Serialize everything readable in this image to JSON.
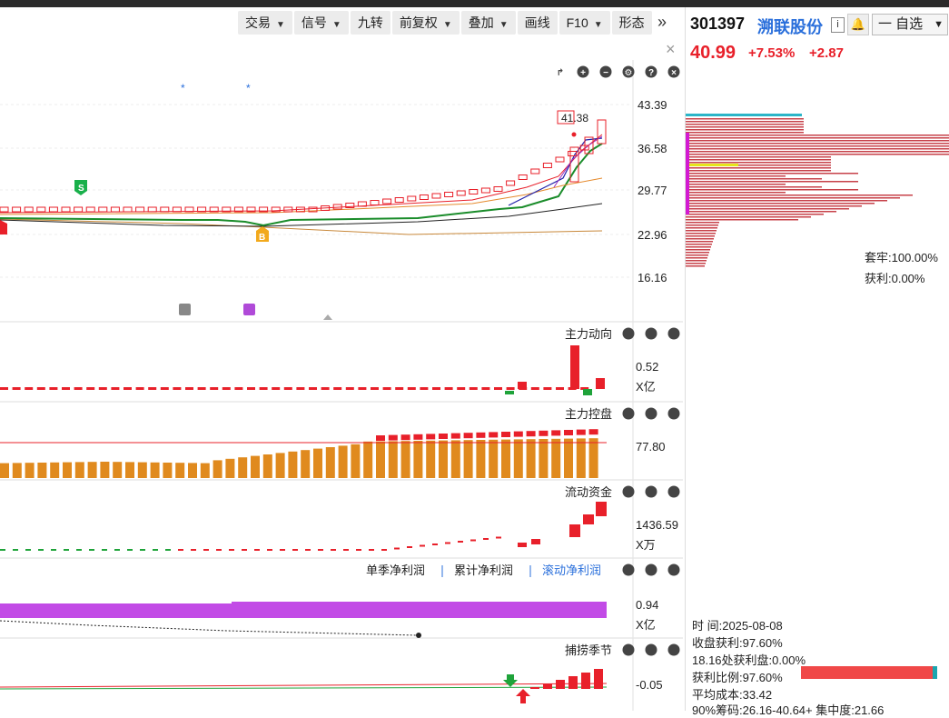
{
  "toolbar": {
    "items": [
      {
        "label": "交易",
        "dropdown": true
      },
      {
        "label": "信号",
        "dropdown": true
      },
      {
        "label": "九转",
        "dropdown": false
      },
      {
        "label": "前复权",
        "dropdown": true
      },
      {
        "label": "叠加",
        "dropdown": true
      },
      {
        "label": "画线",
        "dropdown": false
      },
      {
        "label": "F10",
        "dropdown": true
      },
      {
        "label": "形态",
        "dropdown": false
      }
    ],
    "more_icon": "double-chevron-right-icon",
    "close_icon": "close-icon"
  },
  "chart_controls": [
    "share-icon",
    "zoom-in-icon",
    "zoom-out-icon",
    "settings-icon",
    "help-icon",
    "close-icon"
  ],
  "main_chart": {
    "price_axis": [
      "43.39",
      "36.58",
      "29.77",
      "22.96",
      "16.16"
    ],
    "high_label": "41.38",
    "markers": {
      "sell": "S",
      "buy": "B"
    }
  },
  "panels": [
    {
      "title": "主力动向",
      "value": "0.52",
      "unit": "X亿"
    },
    {
      "title": "主力控盘",
      "value": "77.80",
      "unit": ""
    },
    {
      "title": "流动资金",
      "value": "1436.59",
      "unit": "X万"
    },
    {
      "title": "",
      "tabs": [
        "单季净利润",
        "累计净利润",
        "滚动净利润"
      ],
      "active_tab": 2,
      "value": "0.94",
      "unit": "X亿"
    },
    {
      "title": "捕捞季节",
      "value": "-0.05",
      "unit": ""
    }
  ],
  "colors": {
    "up": "#e8202a",
    "down": "#1fa33a",
    "accent": "#2a6fdb",
    "panel_orange": "#e08a1e",
    "purple_bar": "#c24be6"
  },
  "quote": {
    "code": "301397",
    "name": "溯联股份",
    "info_icon": "i",
    "watch_label": "一 自选",
    "price": "40.99",
    "change_pct": "+7.53%",
    "change_abs": "+2.87"
  },
  "chip": {
    "trapped": "套牢:100.00%",
    "profit": "获利:0.00%",
    "lines": [
      "时        间:2025-08-08",
      "收盘获利:97.60%",
      "18.16处获利盘:0.00%",
      "获利比例:97.60%",
      "平均成本:33.42",
      "90%筹码:26.16-40.64+ 集中度:21.66"
    ],
    "ratio": 0.976
  }
}
